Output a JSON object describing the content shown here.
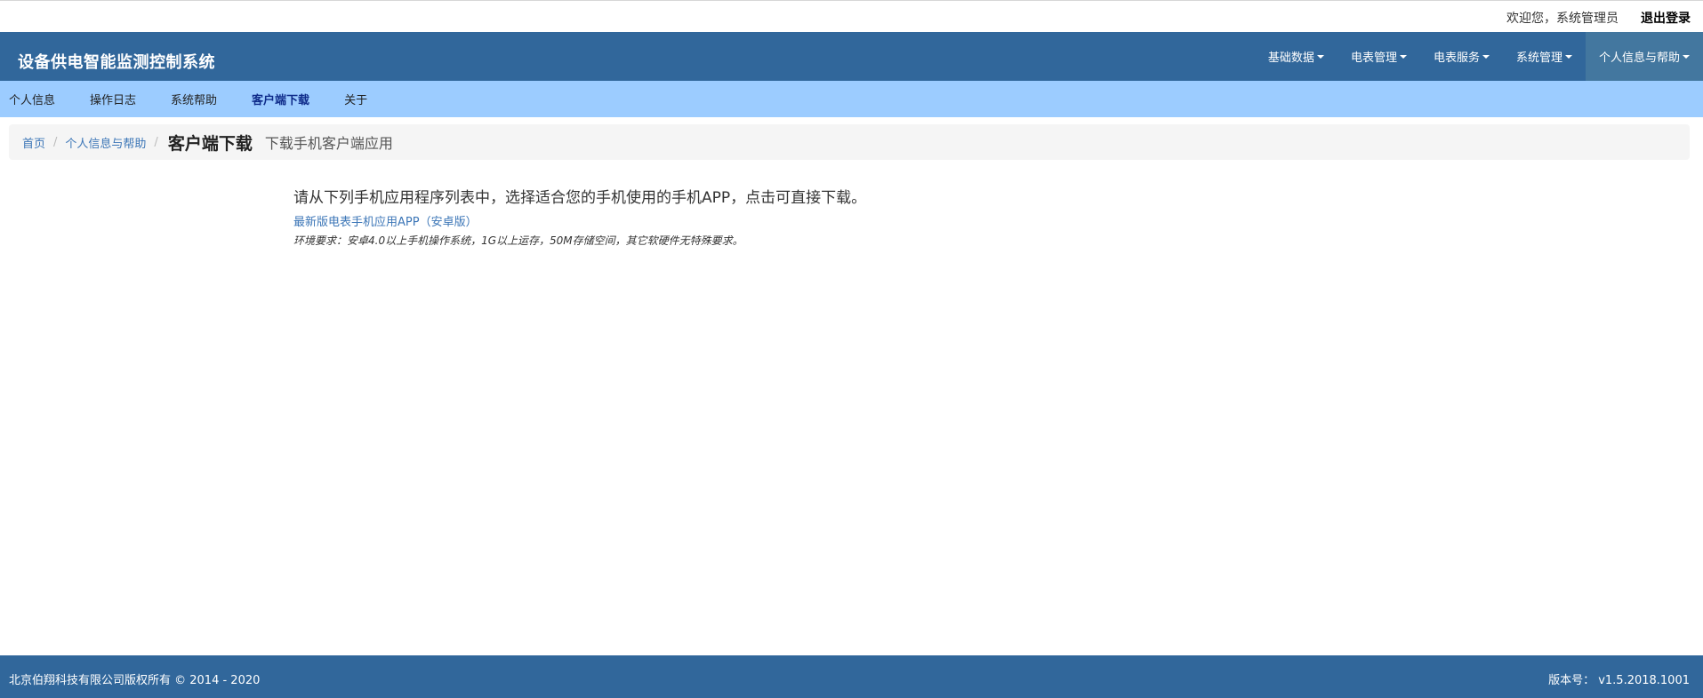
{
  "topbar": {
    "welcome": "欢迎您，系统管理员",
    "logout": "退出登录"
  },
  "navbar": {
    "brand": "设备供电智能监测控制系统",
    "menus": [
      {
        "label": "基础数据"
      },
      {
        "label": "电表管理"
      },
      {
        "label": "电表服务"
      },
      {
        "label": "系统管理"
      },
      {
        "label": "个人信息与帮助"
      }
    ]
  },
  "subnav": {
    "items": [
      {
        "label": "个人信息"
      },
      {
        "label": "操作日志"
      },
      {
        "label": "系统帮助"
      },
      {
        "label": "客户端下载"
      },
      {
        "label": "关于"
      }
    ]
  },
  "breadcrumb": {
    "home": "首页",
    "section": "个人信息与帮助",
    "sep": "/",
    "title": "客户端下载",
    "subtitle": "下载手机客户端应用"
  },
  "content": {
    "intro": "请从下列手机应用程序列表中，选择适合您的手机使用的手机APP，点击可直接下载。",
    "download_link": "最新版电表手机应用APP（安卓版）",
    "requirement": "环境要求：安卓4.0以上手机操作系统，1G以上运存，50M存储空间，其它软硬件无特殊要求。"
  },
  "footer": {
    "copyright": "北京伯翔科技有限公司版权所有 © 2014 - 2020",
    "version": "版本号： v1.5.2018.1001"
  },
  "colors": {
    "navbar": "#31679b",
    "subnav": "#9cccff",
    "link": "#3c76b7",
    "footer": "#31679b"
  }
}
